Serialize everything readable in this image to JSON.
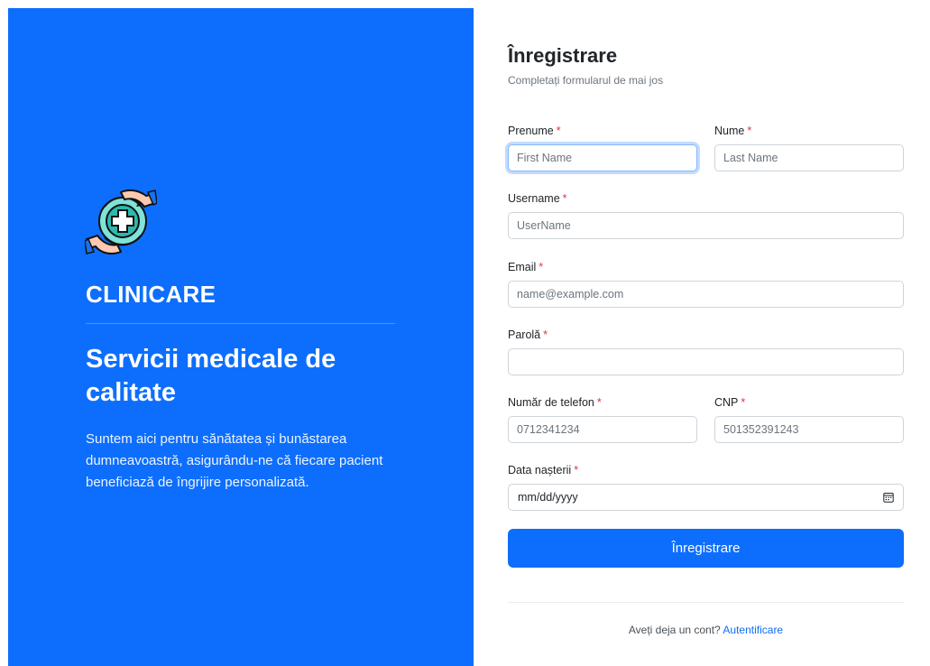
{
  "hero": {
    "brand": "CLINICARE",
    "tagline": "Servicii medicale de calitate",
    "description": "Suntem aici pentru sănătatea și bunăstarea dumneavoastră, asigurându-ne că fiecare pacient beneficiază de îngrijire personalizată.",
    "logo_icon": "hands-medical-cross-icon"
  },
  "form": {
    "title": "Înregistrare",
    "subtitle": "Completați formularul de mai jos",
    "required_mark": "*",
    "fields": {
      "first_name": {
        "label": "Prenume",
        "placeholder": "First Name",
        "value": ""
      },
      "last_name": {
        "label": "Nume",
        "placeholder": "Last Name",
        "value": ""
      },
      "username": {
        "label": "Username",
        "placeholder": "UserName",
        "value": ""
      },
      "email": {
        "label": "Email",
        "placeholder": "name@example.com",
        "value": ""
      },
      "password": {
        "label": "Parolă",
        "placeholder": "",
        "value": ""
      },
      "phone": {
        "label": "Număr de telefon",
        "placeholder": "0712341234",
        "value": ""
      },
      "cnp": {
        "label": "CNP",
        "placeholder": "501352391243",
        "value": ""
      },
      "birth_date": {
        "label": "Data nașterii",
        "display": "mm/dd/yyyy",
        "icon": "calendar-icon"
      }
    },
    "submit_label": "Înregistrare",
    "footer_text": "Aveți deja un cont?",
    "footer_link": "Autentificare"
  },
  "colors": {
    "primary": "#0d6efd",
    "required": "#dc3545",
    "muted": "#6c757d"
  }
}
